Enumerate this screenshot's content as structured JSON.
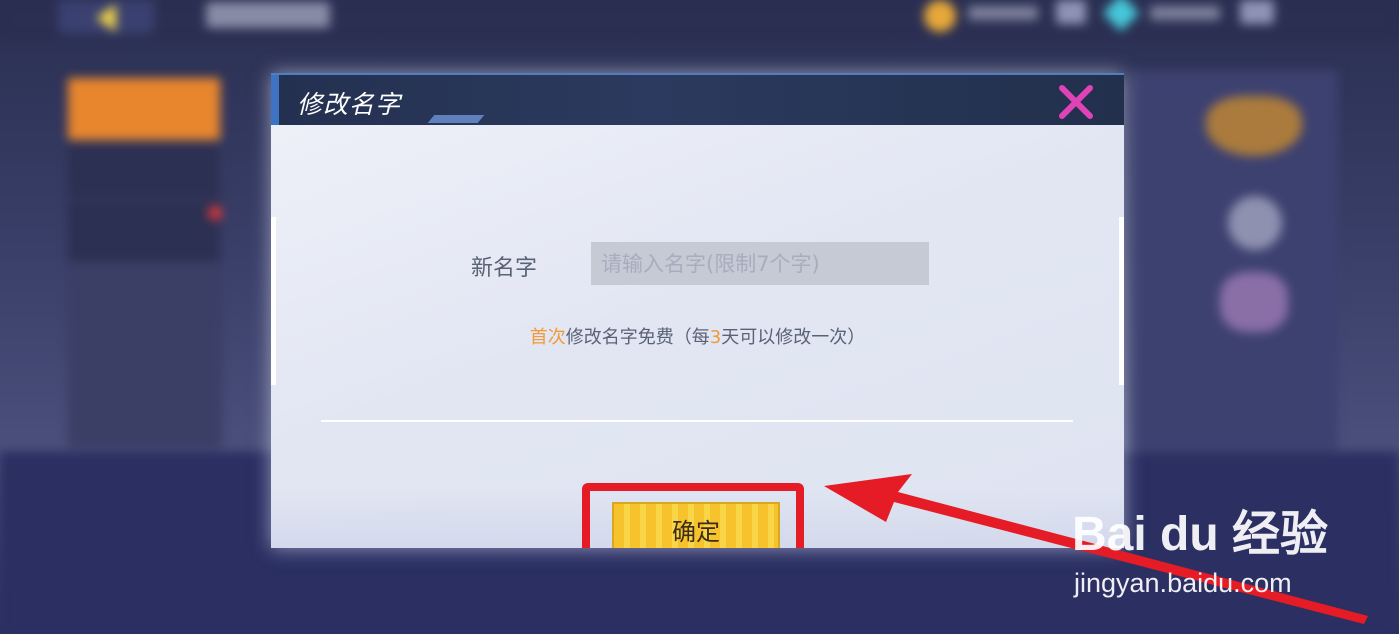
{
  "dialog": {
    "title": "修改名字",
    "name_label": "新名字",
    "name_input_value": "",
    "name_input_placeholder": "请输入名字(限制7个字)",
    "tip_part1": "首次",
    "tip_part2": "修改名字免费（每",
    "tip_part3": "3",
    "tip_part4": "天可以修改一次）",
    "confirm_label": "确定"
  },
  "icons": {
    "close": "close-icon",
    "arrow": "arrow-icon"
  },
  "watermark": {
    "brand": "Bai du 经验",
    "url": "jingyan.baidu.com"
  },
  "colors": {
    "highlight": "#e51b26",
    "tip_accent": "#f29a3a",
    "button": "#f6c32c",
    "close": "#e043b8"
  }
}
